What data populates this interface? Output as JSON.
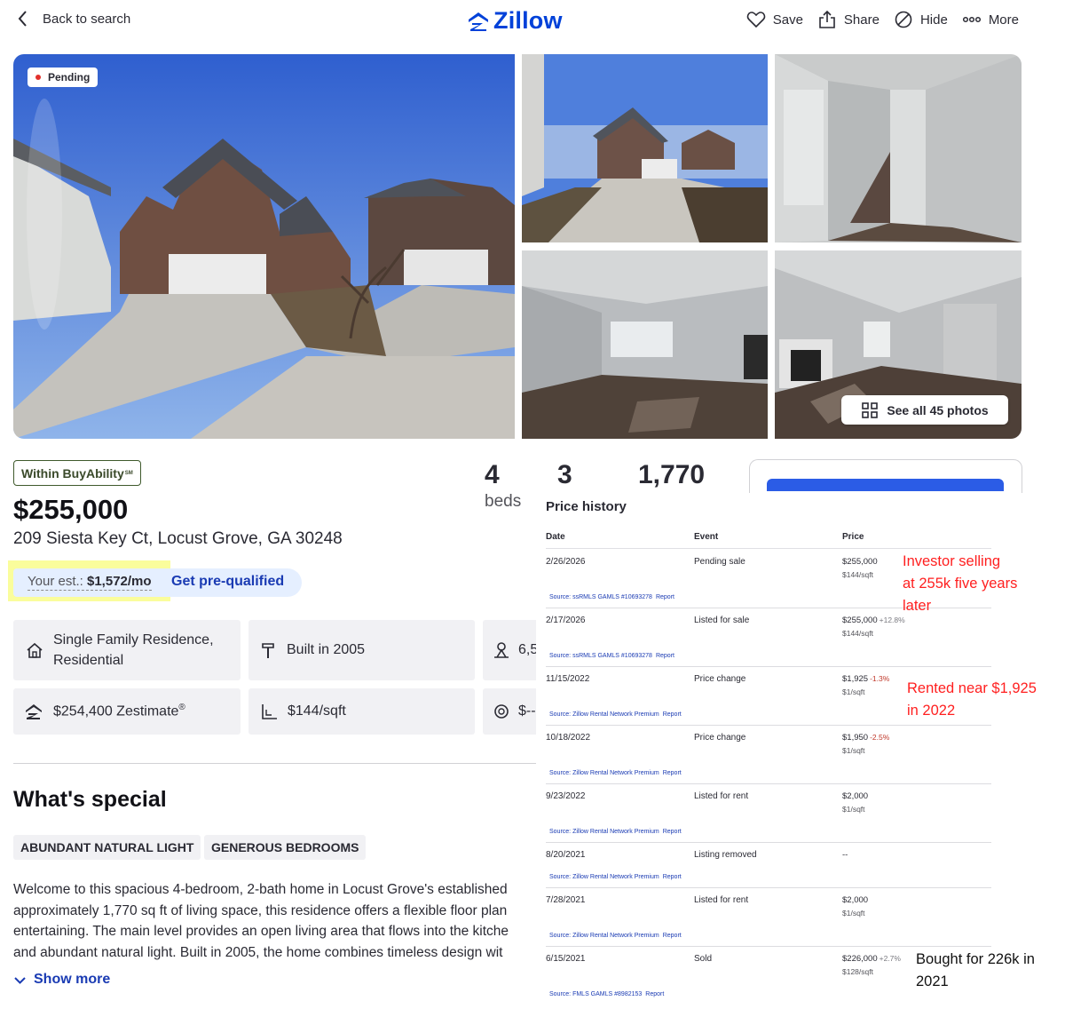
{
  "header": {
    "back_label": "Back to search",
    "logo_text": "Zillow",
    "actions": [
      {
        "label": "Save",
        "icon": "heart-icon"
      },
      {
        "label": "Share",
        "icon": "share-icon"
      },
      {
        "label": "Hide",
        "icon": "hide-icon"
      },
      {
        "label": "More",
        "icon": "more-icon"
      }
    ]
  },
  "photos": {
    "status_badge": "Pending",
    "see_all_label": "See all 45 photos"
  },
  "summary": {
    "buyability": "Within BuyAbility",
    "buyability_mark": "SM",
    "price": "$255,000",
    "address": "209 Siesta Key Ct, Locust Grove, GA 30248",
    "est_label": "Your est.:",
    "est_value": "$1,572/mo",
    "prequal_label": "Get pre-qualified",
    "beds": "4",
    "beds_label": "beds",
    "baths": "3",
    "sqft": "1,770"
  },
  "facts": {
    "type_line1": "Single Family Residence,",
    "type_line2": "Residential",
    "built": "Built in 2005",
    "lot": "6,5",
    "zestimate": "$254,400 Zestimate",
    "zestimate_mark": "®",
    "price_sqft": "$144/sqft",
    "hoa": "$--"
  },
  "special": {
    "title": "What's special",
    "tags": [
      "ABUNDANT NATURAL LIGHT",
      "GENEROUS BEDROOMS"
    ],
    "description_lines": [
      "Welcome to this spacious 4-bedroom, 2-bath home in Locust Grove's established",
      "approximately 1,770 sq ft of living space, this residence offers a flexible floor plan",
      "entertaining. The main level provides an open living area that flows into the kitche",
      "and abundant natural light. Built in 2005, the home combines timeless design wit"
    ],
    "show_more": "Show more"
  },
  "price_history": {
    "title": "Price history",
    "columns": [
      "Date",
      "Event",
      "Price"
    ],
    "rows": [
      {
        "date": "2/26/2026",
        "event": "Pending sale",
        "price": "$255,000",
        "change": "",
        "change_dir": "",
        "per_sqft": "$144/sqft",
        "source": "Source: ssRMLS GAMLS #10693278",
        "report": "Report"
      },
      {
        "date": "2/17/2026",
        "event": "Listed for sale",
        "price": "$255,000",
        "change": "+12.8%",
        "change_dir": "up",
        "per_sqft": "$144/sqft",
        "source": "Source: ssRMLS GAMLS #10693278",
        "report": "Report"
      },
      {
        "date": "11/15/2022",
        "event": "Price change",
        "price": "$1,925",
        "change": "-1.3%",
        "change_dir": "down",
        "per_sqft": "$1/sqft",
        "source": "Source: Zillow Rental Network Premium",
        "report": "Report"
      },
      {
        "date": "10/18/2022",
        "event": "Price change",
        "price": "$1,950",
        "change": "-2.5%",
        "change_dir": "down",
        "per_sqft": "$1/sqft",
        "source": "Source: Zillow Rental Network Premium",
        "report": "Report"
      },
      {
        "date": "9/23/2022",
        "event": "Listed for rent",
        "price": "$2,000",
        "change": "",
        "change_dir": "",
        "per_sqft": "$1/sqft",
        "source": "Source: Zillow Rental Network Premium",
        "report": "Report"
      },
      {
        "date": "8/20/2021",
        "event": "Listing removed",
        "price": "--",
        "change": "",
        "change_dir": "",
        "per_sqft": "",
        "source": "Source: Zillow Rental Network Premium",
        "report": "Report"
      },
      {
        "date": "7/28/2021",
        "event": "Listed for rent",
        "price": "$2,000",
        "change": "",
        "change_dir": "",
        "per_sqft": "$1/sqft",
        "source": "Source: Zillow Rental Network Premium",
        "report": "Report"
      },
      {
        "date": "6/15/2021",
        "event": "Sold",
        "price": "$226,000",
        "change": "+2.7%",
        "change_dir": "up",
        "per_sqft": "$128/sqft",
        "source": "Source: FMLS GAMLS #8982153",
        "report": "Report"
      }
    ]
  },
  "annotations": {
    "investor_lines": [
      "Investor selling",
      "at 255k five years",
      "later"
    ],
    "rented_lines": [
      "Rented near $1,925",
      "in 2022"
    ],
    "bought_lines": [
      "Bought for 226k in",
      "2021"
    ]
  },
  "colors": {
    "brand": "#0041d9",
    "link": "#1a3bb3",
    "annotation_red": "#ff1f1f",
    "highlight": "#fafd9c",
    "pending_dot": "#e2302b"
  }
}
